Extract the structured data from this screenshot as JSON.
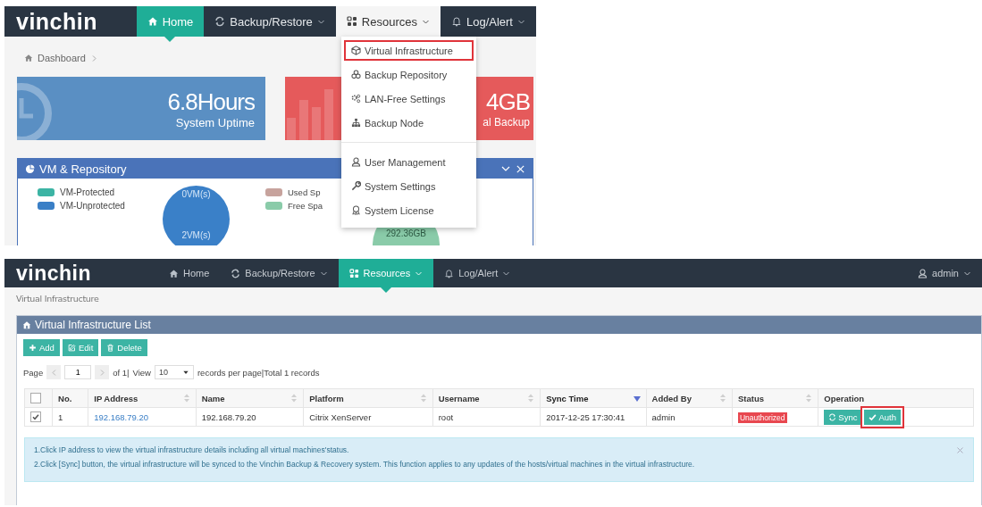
{
  "dashboard_screen": {
    "logo": "vinchin",
    "nav": [
      {
        "label": "Home",
        "selected": true,
        "caret": false,
        "open": false
      },
      {
        "label": "Backup/Restore",
        "selected": false,
        "caret": true,
        "open": false
      },
      {
        "label": "Resources",
        "selected": false,
        "caret": true,
        "open": true
      },
      {
        "label": "Log/Alert",
        "selected": false,
        "caret": true,
        "open": false
      }
    ],
    "breadcrumb": "Dashboard",
    "stat_cards": [
      {
        "kind": "uptime",
        "value": "6.8Hours",
        "label": "System Uptime"
      },
      {
        "kind": "backup",
        "value": "4GB",
        "label": "al Backup"
      }
    ],
    "panel": {
      "title": "VM & Repository",
      "legend_left": [
        {
          "label": "VM-Protected",
          "color": "#3cb4a4"
        },
        {
          "label": "VM-Unprotected",
          "color": "#3a7fc6"
        }
      ],
      "legend_right": [
        {
          "label": "Used Sp",
          "color": "#c7a39d"
        },
        {
          "label": "Free Spa",
          "color": "#8acba9"
        }
      ],
      "pie_left_labels": [
        "0VM(s)",
        "2VM(s)"
      ],
      "pie_right_label": "292.36GB"
    },
    "dropdown": {
      "groups": [
        {
          "items": [
            {
              "label": "Virtual Infrastructure",
              "highlighted": true
            },
            {
              "label": "Backup Repository",
              "highlighted": false
            },
            {
              "label": "LAN-Free Settings",
              "highlighted": false
            },
            {
              "label": "Backup Node",
              "highlighted": false
            }
          ]
        },
        {
          "items": [
            {
              "label": "User Management",
              "highlighted": false
            },
            {
              "label": "System Settings",
              "highlighted": false
            },
            {
              "label": "System License",
              "highlighted": false
            }
          ]
        }
      ]
    }
  },
  "resources_screen": {
    "logo": "vinchin",
    "nav": [
      {
        "label": "Home",
        "selected": false,
        "caret": false
      },
      {
        "label": "Backup/Restore",
        "selected": false,
        "caret": true
      },
      {
        "label": "Resources",
        "selected": true,
        "caret": true
      },
      {
        "label": "Log/Alert",
        "selected": false,
        "caret": true
      }
    ],
    "user": "admin",
    "breadcrumb": "Virtual Infrastructure",
    "panel_title": "Virtual Infrastructure List",
    "toolbar": [
      {
        "label": "Add"
      },
      {
        "label": "Edit"
      },
      {
        "label": "Delete"
      }
    ],
    "pagination": {
      "page_label": "Page",
      "page": "1",
      "of_text": "of 1|",
      "view_label": "View",
      "per_page": "10",
      "summary": "records per page|Total 1 records"
    },
    "table": {
      "columns": [
        {
          "kind": "check",
          "checked": false
        },
        {
          "label": "No.",
          "sortable": false,
          "sorted": false
        },
        {
          "label": "IP Address",
          "sortable": true,
          "sorted": false
        },
        {
          "label": "Name",
          "sortable": true,
          "sorted": false
        },
        {
          "label": "Platform",
          "sortable": true,
          "sorted": false
        },
        {
          "label": "Username",
          "sortable": true,
          "sorted": false
        },
        {
          "label": "Sync Time",
          "sortable": true,
          "sorted": true
        },
        {
          "label": "Added By",
          "sortable": true,
          "sorted": false
        },
        {
          "label": "Status",
          "sortable": true,
          "sorted": false
        },
        {
          "label": "Operation",
          "sortable": false,
          "sorted": false
        }
      ],
      "rows": [
        {
          "checked": true,
          "no": "1",
          "ip": "192.168.79.20",
          "name": "192.168.79.20",
          "platform": "Citrix XenServer",
          "username": "root",
          "sync_time": "2017-12-25 17:30:41",
          "added_by": "admin",
          "status": {
            "label": "Unauthorized",
            "kind": "danger"
          },
          "operations": [
            {
              "label": "Sync",
              "highlighted": false
            },
            {
              "label": "Auth",
              "highlighted": true
            }
          ]
        }
      ]
    },
    "notes": [
      "1.Click IP address to view the virtual infrastructure details including all virtual machines'status.",
      "2.Click [Sync] button, the virtual infrastructure will be synced to the Vinchin Backup & Recovery system. This function applies to any updates of the hosts/virtual machines in the virtual infrastructure."
    ]
  }
}
